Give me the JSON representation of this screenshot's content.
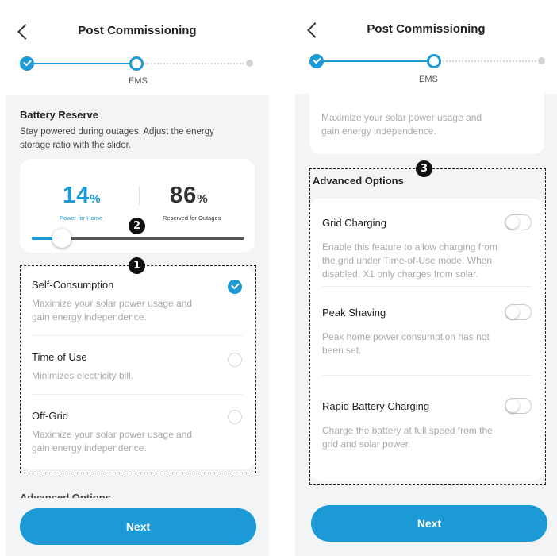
{
  "left": {
    "header": {
      "title": "Post Commissioning",
      "step_label": "EMS"
    },
    "battery": {
      "title": "Battery Reserve",
      "description_line1": "Stay powered during outages. Adjust the energy",
      "description_line2": "storage ratio with the slider.",
      "home_value": "14",
      "home_unit": "%",
      "home_label": "Power for Home",
      "reserve_value": "86",
      "reserve_unit": "%",
      "reserve_label": "Reserved for Outages",
      "slider_fraction": 0.14
    },
    "modes": [
      {
        "title": "Self-Consumption",
        "desc1": "Maximize your solar power usage and",
        "desc2": "gain energy independence.",
        "selected": true
      },
      {
        "title": "Time of Use",
        "desc1": "Minimizes electricity bill.",
        "desc2": "",
        "selected": false
      },
      {
        "title": "Off-Grid",
        "desc1": "Maximize your solar power usage and",
        "desc2": "gain energy independence.",
        "selected": false
      }
    ],
    "cut_off_heading": "Advanced Options",
    "next_label": "Next",
    "badges": {
      "slider": "2",
      "modes": "1"
    }
  },
  "right": {
    "header": {
      "title": "Post Commissioning",
      "step_label": "EMS"
    },
    "top_card": {
      "desc1": "Maximize your solar power usage and",
      "desc2": "gain energy independence."
    },
    "advanced": {
      "title": "Advanced Options",
      "options": [
        {
          "title": "Grid Charging",
          "desc1": "Enable this feature to allow charging from",
          "desc2": "the grid under Time-of-Use mode. When",
          "desc3": "disabled, X1 only charges from solar.",
          "enabled": false
        },
        {
          "title": "Peak Shaving",
          "desc1": "Peak home power consumption has not",
          "desc2": "been set.",
          "desc3": "",
          "enabled": false
        },
        {
          "title": "Rapid Battery Charging",
          "desc1": "Charge the battery at full speed from the",
          "desc2": "grid and solar power.",
          "desc3": "",
          "enabled": false
        }
      ]
    },
    "next_label": "Next",
    "badges": {
      "advanced": "3"
    }
  },
  "colors": {
    "accent": "#1b9ad6",
    "background": "#f3f4f6",
    "card": "#ffffff",
    "muted_text": "#aaaaaa"
  },
  "icons": {
    "back": "chevron-left-icon",
    "step_done": "check-circle-icon",
    "radio_checked": "check-circle-icon"
  }
}
